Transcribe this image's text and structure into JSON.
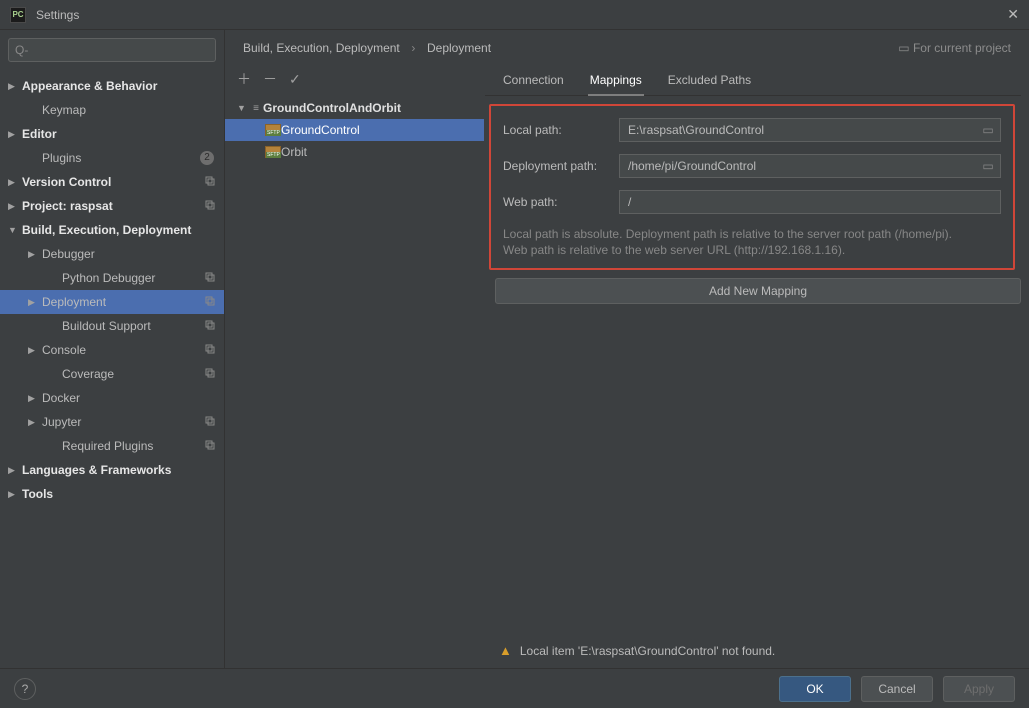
{
  "window": {
    "title": "Settings"
  },
  "search": {
    "placeholder": "Q-"
  },
  "sidebar": [
    {
      "label": "Appearance & Behavior",
      "bold": true,
      "arrow": "▶",
      "indent": 0
    },
    {
      "label": "Keymap",
      "indent": 1
    },
    {
      "label": "Editor",
      "bold": true,
      "arrow": "▶",
      "indent": 0
    },
    {
      "label": "Plugins",
      "indent": 1,
      "badge": "2"
    },
    {
      "label": "Version Control",
      "bold": true,
      "arrow": "▶",
      "indent": 0,
      "copy": true
    },
    {
      "label": "Project: raspsat",
      "bold": true,
      "arrow": "▶",
      "indent": 0,
      "copy": true
    },
    {
      "label": "Build, Execution, Deployment",
      "bold": true,
      "arrow": "▼",
      "indent": 0
    },
    {
      "label": "Debugger",
      "arrow": "▶",
      "indent": 1
    },
    {
      "label": "Python Debugger",
      "indent": 2,
      "copy": true
    },
    {
      "label": "Deployment",
      "arrow": "▶",
      "indent": 1,
      "copy": true,
      "selected": true
    },
    {
      "label": "Buildout Support",
      "indent": 2,
      "copy": true
    },
    {
      "label": "Console",
      "arrow": "▶",
      "indent": 1,
      "copy": true
    },
    {
      "label": "Coverage",
      "indent": 2,
      "copy": true
    },
    {
      "label": "Docker",
      "arrow": "▶",
      "indent": 1
    },
    {
      "label": "Jupyter",
      "arrow": "▶",
      "indent": 1,
      "copy": true
    },
    {
      "label": "Required Plugins",
      "indent": 2,
      "copy": true
    },
    {
      "label": "Languages & Frameworks",
      "bold": true,
      "arrow": "▶",
      "indent": 0
    },
    {
      "label": "Tools",
      "bold": true,
      "arrow": "▶",
      "indent": 0
    }
  ],
  "breadcrumb": {
    "a": "Build, Execution, Deployment",
    "b": "Deployment",
    "current": "For current project"
  },
  "deploy_tree": {
    "root": "GroundControlAndOrbit",
    "children": [
      {
        "label": "GroundControl",
        "selected": true
      },
      {
        "label": "Orbit"
      }
    ]
  },
  "tabs": [
    "Connection",
    "Mappings",
    "Excluded Paths"
  ],
  "active_tab": "Mappings",
  "mapping": {
    "local_label": "Local path:",
    "local_value": "E:\\raspsat\\GroundControl",
    "deploy_label": "Deployment path:",
    "deploy_value": "/home/pi/GroundControl",
    "web_label": "Web path:",
    "web_value": "/",
    "hint1": "Local path is absolute. Deployment path is relative to the server root path (/home/pi).",
    "hint2": "Web path is relative to the web server URL (http://192.168.1.16)."
  },
  "add_mapping": "Add New Mapping",
  "warning": "Local item 'E:\\raspsat\\GroundControl' not found.",
  "buttons": {
    "ok": "OK",
    "cancel": "Cancel",
    "apply": "Apply"
  }
}
